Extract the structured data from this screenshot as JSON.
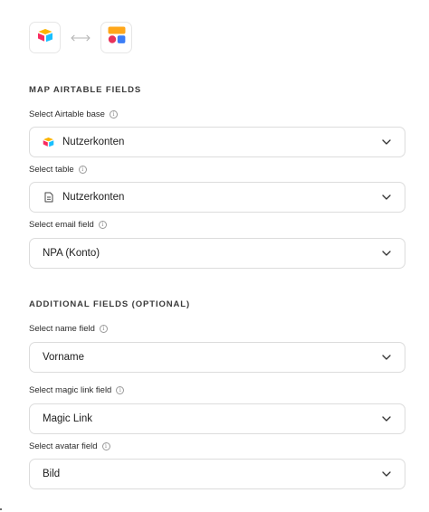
{
  "integration": {
    "left_logo": "airtable-logo-icon",
    "link": "bidirectional-arrow-icon",
    "right_logo": "app-shapes-logo-icon"
  },
  "map_section": {
    "title": "MAP AIRTABLE FIELDS",
    "base": {
      "label": "Select Airtable base",
      "value": "Nutzerkonten",
      "icon": "airtable-logo-icon"
    },
    "table": {
      "label": "Select table",
      "value": "Nutzerkonten",
      "icon": "document-icon"
    },
    "email": {
      "label": "Select email field",
      "value": "NPA (Konto)"
    }
  },
  "additional_section": {
    "title": "ADDITIONAL FIELDS (OPTIONAL)",
    "name": {
      "label": "Select name field",
      "value": "Vorname"
    },
    "magic_link": {
      "label": "Select magic link field",
      "value": "Magic Link"
    },
    "avatar": {
      "label": "Select avatar field",
      "value": "Bild"
    }
  },
  "colors": {
    "airtable_yellow": "#fcb400",
    "airtable_blue": "#18bfff",
    "airtable_red": "#f82b60",
    "brand_orange": "#ffa71a",
    "brand_pink": "#e8335b",
    "brand_blue": "#3b7df6"
  }
}
